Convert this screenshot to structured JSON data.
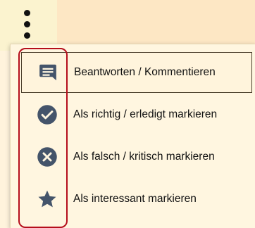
{
  "menu": {
    "items": [
      {
        "label": "Beantworten / Kommentieren",
        "icon": "comment-icon"
      },
      {
        "label": "Als richtig / erledigt markieren",
        "icon": "check-circle-icon"
      },
      {
        "label": "Als falsch / kritisch markieren",
        "icon": "x-circle-icon"
      },
      {
        "label": "Als interessant markieren",
        "icon": "star-icon"
      }
    ]
  },
  "colors": {
    "icon": "#44546a",
    "highlight": "#b50e1c",
    "toolbar_left": "#fbf3cf",
    "toolbar_right": "#fde7c4",
    "menu_background": "#fff6e0"
  }
}
